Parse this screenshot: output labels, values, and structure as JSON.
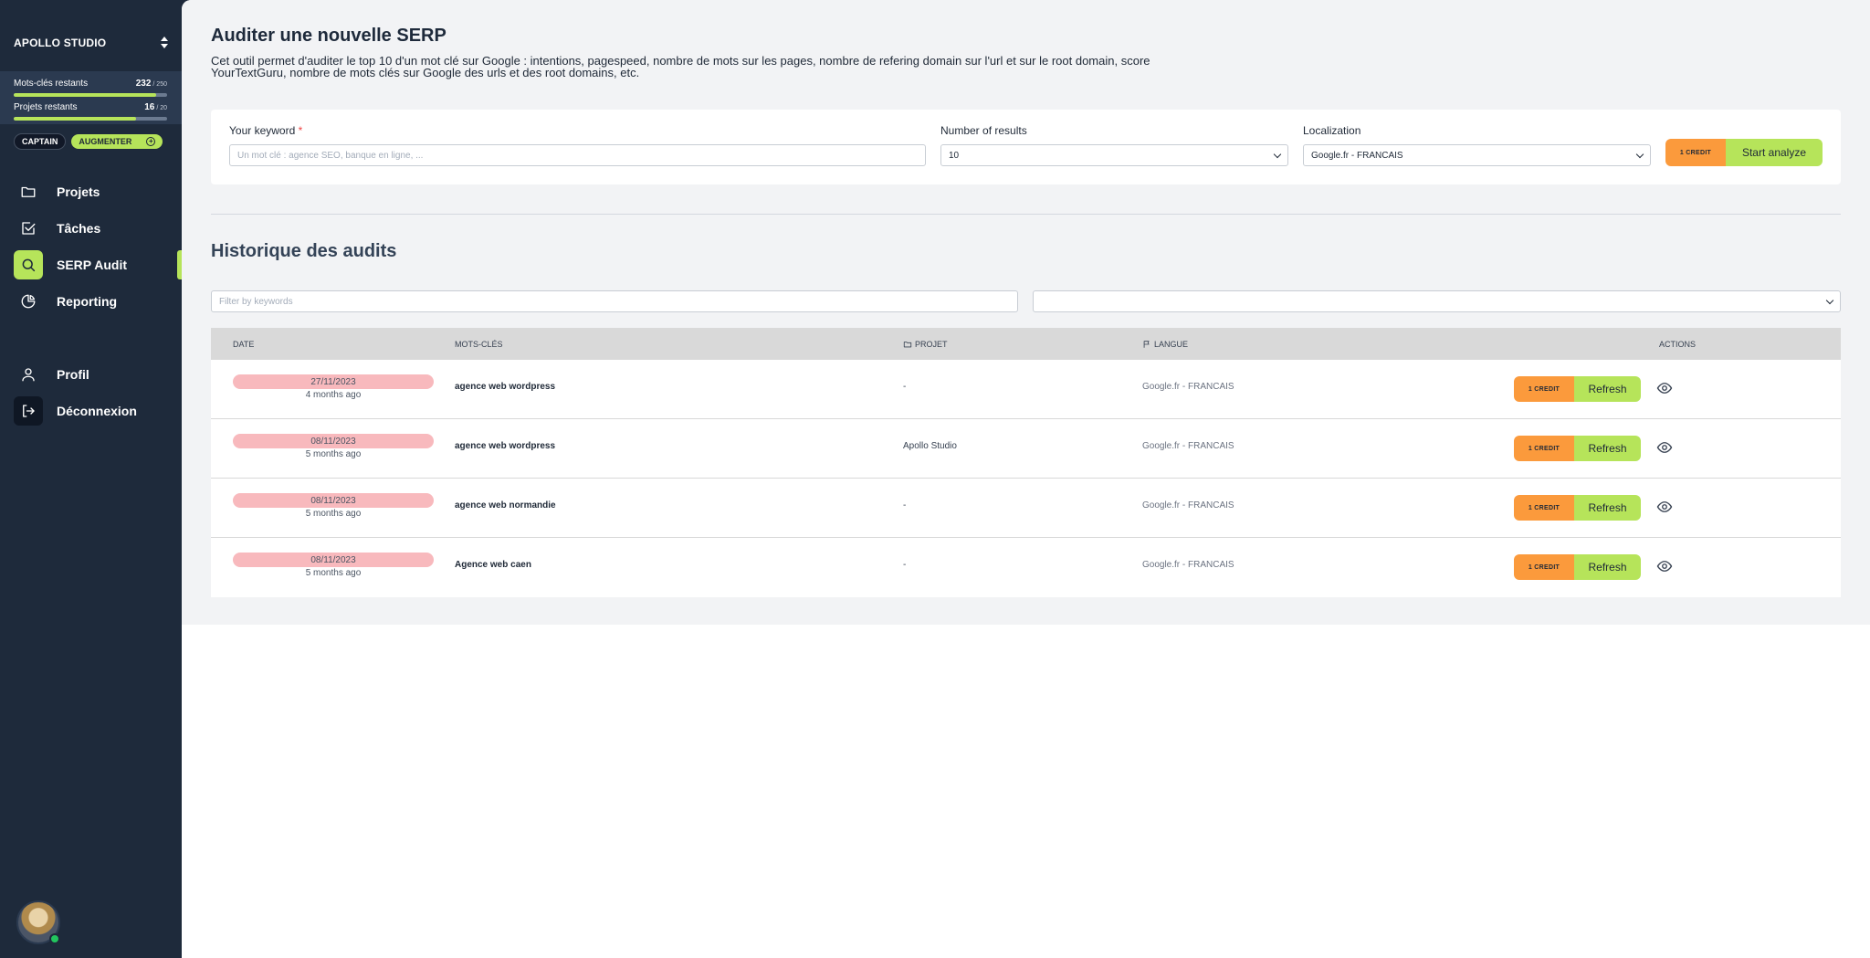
{
  "sidebar": {
    "org_name": "APOLLO STUDIO",
    "quotas": [
      {
        "label": "Mots-clés restants",
        "value": "232",
        "max": "/ 250",
        "fraction": 0.928
      },
      {
        "label": "Projets restants",
        "value": "16",
        "max": "/ 20",
        "fraction": 0.8
      }
    ],
    "plan_label": "CAPTAIN",
    "upgrade_label": "AUGMENTER",
    "nav": [
      {
        "label": "Projets",
        "icon": "folder-icon"
      },
      {
        "label": "Tâches",
        "icon": "checkbox-icon"
      },
      {
        "label": "SERP Audit",
        "icon": "search-icon",
        "active": true
      },
      {
        "label": "Reporting",
        "icon": "pie-chart-icon"
      }
    ],
    "nav_bottom": [
      {
        "label": "Profil",
        "icon": "user-icon"
      },
      {
        "label": "Déconnexion",
        "icon": "logout-icon"
      }
    ]
  },
  "header": {
    "title": "Auditer une nouvelle SERP",
    "description": "Cet outil permet d'auditer le top 10 d'un mot clé sur Google : intentions, pagespeed, nombre de mots sur les pages, nombre de refering domain sur l'url et sur le root domain, score YourTextGuru, nombre de mots clés sur Google des urls et des root domains, etc."
  },
  "form": {
    "keyword_label": "Your keyword",
    "keyword_required": "*",
    "keyword_placeholder": "Un mot clé : agence SEO, banque en ligne, ...",
    "results_label": "Number of results",
    "results_value": "10",
    "localization_label": "Localization",
    "localization_value": "Google.fr - FRANCAIS",
    "credit_label": "1 CREDIT",
    "start_label": "Start analyze"
  },
  "history": {
    "title": "Historique des audits",
    "filter_placeholder": "Filter by keywords",
    "filter_select_value": "",
    "columns": {
      "date": "DATE",
      "keywords": "MOTS-CLÉS",
      "project": "PROJET",
      "language": "LANGUE",
      "actions": "ACTIONS"
    },
    "credit_label": "1 CREDIT",
    "refresh_label": "Refresh",
    "rows": [
      {
        "date": "27/11/2023",
        "ago": "4 months ago",
        "keyword": "agence web wordpress",
        "project": "-",
        "language": "Google.fr - FRANCAIS"
      },
      {
        "date": "08/11/2023",
        "ago": "5 months ago",
        "keyword": "agence web wordpress",
        "project": "Apollo Studio",
        "language": "Google.fr - FRANCAIS"
      },
      {
        "date": "08/11/2023",
        "ago": "5 months ago",
        "keyword": "agence web normandie",
        "project": "-",
        "language": "Google.fr - FRANCAIS"
      },
      {
        "date": "08/11/2023",
        "ago": "5 months ago",
        "keyword": "Agence web caen",
        "project": "-",
        "language": "Google.fr - FRANCAIS"
      }
    ]
  },
  "colors": {
    "accent": "#b6e45a",
    "credit": "#fb9a3c",
    "sidebar": "#1e2a3b",
    "date_pill": "#f8b9bd"
  }
}
